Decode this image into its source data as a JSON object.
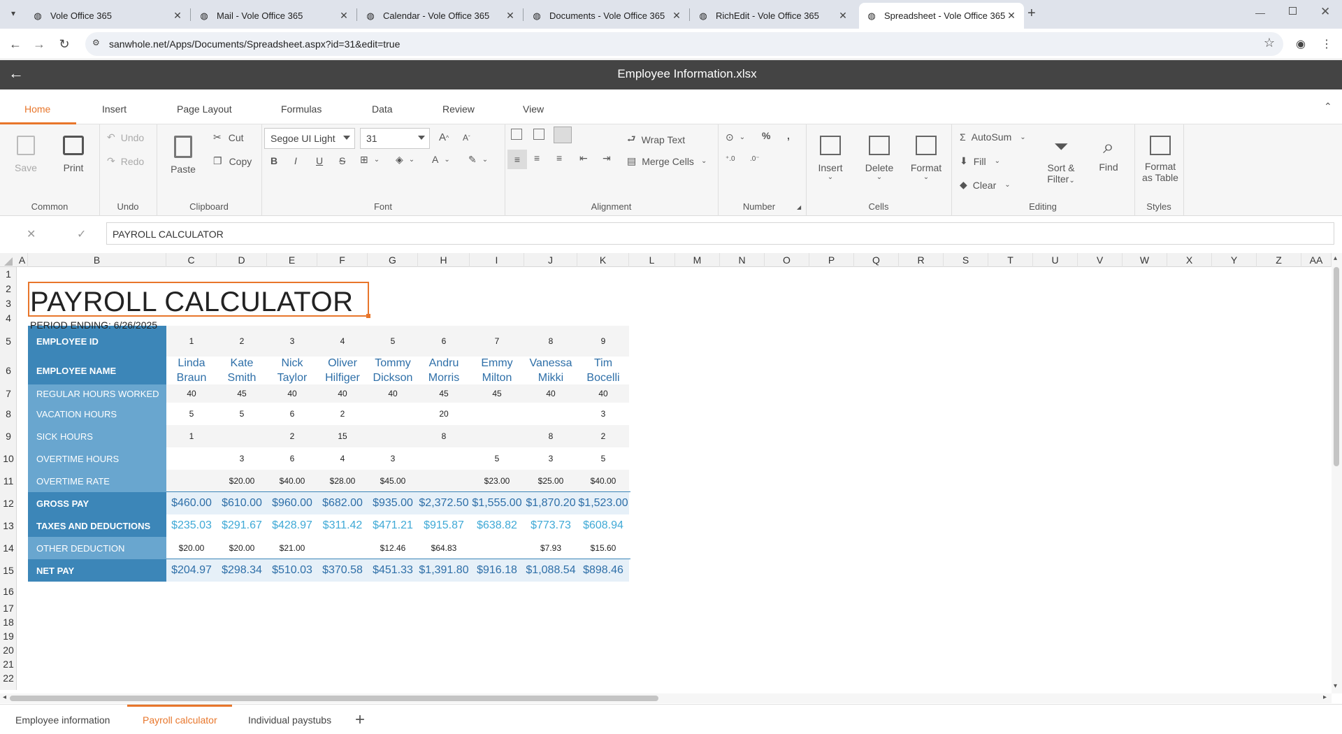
{
  "browser": {
    "tabs": [
      {
        "title": "Vole Office 365",
        "active": false
      },
      {
        "title": "Mail - Vole Office 365",
        "active": false
      },
      {
        "title": "Calendar - Vole Office 365",
        "active": false
      },
      {
        "title": "Documents - Vole Office 365",
        "active": false
      },
      {
        "title": "RichEdit - Vole Office 365",
        "active": false
      },
      {
        "title": "Spreadsheet - Vole Office 365",
        "active": true
      }
    ],
    "new_tab_label": "+",
    "url": "sanwhole.net/Apps/Documents/Spreadsheet.aspx?id=31&edit=true"
  },
  "app": {
    "title": "Employee Information.xlsx",
    "accent": "#e8762b"
  },
  "ribbon_tabs": [
    "Home",
    "Insert",
    "Page Layout",
    "Formulas",
    "Data",
    "Review",
    "View"
  ],
  "ribbon": {
    "common": {
      "save": "Save",
      "print": "Print",
      "group": "Common"
    },
    "undo": {
      "undo": "Undo",
      "redo": "Redo",
      "group": "Undo"
    },
    "clipboard": {
      "paste": "Paste",
      "cut": "Cut",
      "copy": "Copy",
      "group": "Clipboard"
    },
    "font": {
      "family": "Segoe UI Light",
      "size": "31",
      "group": "Font"
    },
    "alignment": {
      "wrap": "Wrap Text",
      "merge": "Merge Cells",
      "group": "Alignment"
    },
    "number": {
      "group": "Number",
      "percent": "%",
      "comma": ","
    },
    "cells": {
      "insert": "Insert",
      "delete": "Delete",
      "format": "Format",
      "group": "Cells"
    },
    "editing": {
      "autosum": "AutoSum",
      "fill": "Fill",
      "clear": "Clear",
      "sort1": "Sort &",
      "sort2": "Filter",
      "find": "Find",
      "group": "Editing"
    },
    "styles": {
      "fmt1": "Format",
      "fmt2": "as Table",
      "group": "Styles"
    }
  },
  "formula_bar": {
    "value": "PAYROLL CALCULATOR"
  },
  "columns": [
    "A",
    "B",
    "C",
    "D",
    "E",
    "F",
    "G",
    "H",
    "I",
    "J",
    "K",
    "L",
    "M",
    "N",
    "O",
    "P",
    "Q",
    "R",
    "S",
    "T",
    "U",
    "V",
    "W",
    "X",
    "Y",
    "Z",
    "AA"
  ],
  "rows": [
    "1",
    "2",
    "3",
    "4",
    "5",
    "6",
    "7",
    "8",
    "9",
    "10",
    "11",
    "12",
    "13",
    "14",
    "15",
    "16",
    "17",
    "18",
    "19",
    "20",
    "21",
    "22"
  ],
  "sheet": {
    "title": "PAYROLL CALCULATOR",
    "period": "PERIOD ENDING: 6/26/2025",
    "labels": [
      "EMPLOYEE ID",
      "EMPLOYEE NAME",
      "REGULAR HOURS WORKED",
      "VACATION HOURS",
      "SICK HOURS",
      "OVERTIME HOURS",
      "OVERTIME RATE",
      "GROSS PAY",
      "TAXES AND DEDUCTIONS",
      "OTHER DEDUCTION",
      "NET PAY"
    ],
    "employee_ids": [
      "1",
      "2",
      "3",
      "4",
      "5",
      "6",
      "7",
      "8",
      "9"
    ],
    "first_names": [
      "Linda",
      "Kate",
      "Nick",
      "Oliver",
      "Tommy",
      "Andru",
      "Emmy",
      "Vanessa",
      "Tim"
    ],
    "last_names": [
      "Braun",
      "Smith",
      "Taylor",
      "Hilfiger",
      "Dickson",
      "Morris",
      "Milton",
      "Mikki",
      "Bocelli"
    ],
    "regular_hours": [
      "40",
      "45",
      "40",
      "40",
      "40",
      "45",
      "45",
      "40",
      "40"
    ],
    "vacation_hours": [
      "5",
      "5",
      "6",
      "2",
      "",
      "20",
      "",
      "",
      "3"
    ],
    "sick_hours": [
      "1",
      "",
      "2",
      "15",
      "",
      "8",
      "",
      "8",
      "2"
    ],
    "overtime_hours": [
      "",
      "3",
      "6",
      "4",
      "3",
      "",
      "5",
      "3",
      "5"
    ],
    "overtime_rate": [
      "",
      "$20.00",
      "$40.00",
      "$28.00",
      "$45.00",
      "",
      "$23.00",
      "$25.00",
      "$40.00"
    ],
    "gross_pay": [
      "$460.00",
      "$610.00",
      "$960.00",
      "$682.00",
      "$935.00",
      "$2,372.50",
      "$1,555.00",
      "$1,870.20",
      "$1,523.00"
    ],
    "taxes": [
      "$235.03",
      "$291.67",
      "$428.97",
      "$311.42",
      "$471.21",
      "$915.87",
      "$638.82",
      "$773.73",
      "$608.94"
    ],
    "other_deduction": [
      "$20.00",
      "$20.00",
      "$21.00",
      "",
      "$12.46",
      "$64.83",
      "",
      "$7.93",
      "$15.60"
    ],
    "net_pay": [
      "$204.97",
      "$298.34",
      "$510.03",
      "$370.58",
      "$451.33",
      "$1,391.80",
      "$916.18",
      "$1,088.54",
      "$898.46"
    ]
  },
  "sheet_tabs": [
    {
      "label": "Employee information",
      "active": false
    },
    {
      "label": "Payroll calculator",
      "active": true
    },
    {
      "label": "Individual paystubs",
      "active": false
    }
  ],
  "add_sheet_label": "+"
}
